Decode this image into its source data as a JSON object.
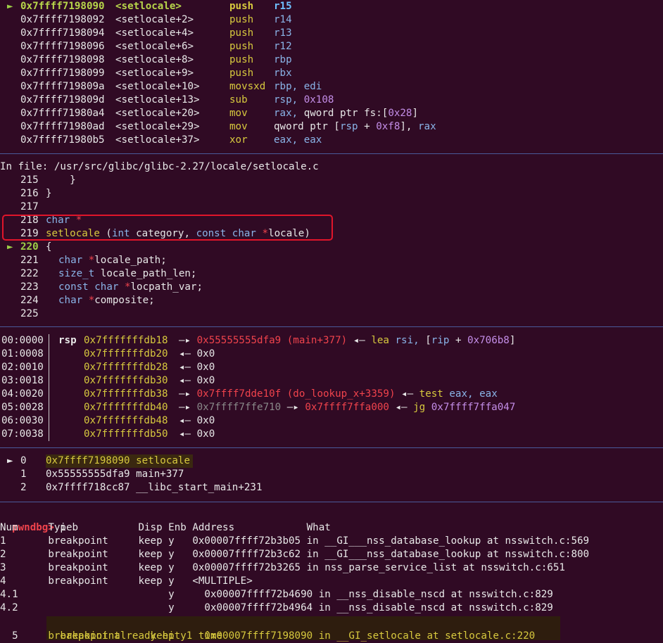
{
  "disasm": [
    {
      "marker": "►",
      "addr": "0x7ffff7198090",
      "sym": "<setlocale>",
      "op": "push",
      "args": "r15",
      "current": true
    },
    {
      "marker": "",
      "addr": "0x7ffff7198092",
      "sym": "<setlocale+2>",
      "op": "push",
      "args": "r14"
    },
    {
      "marker": "",
      "addr": "0x7ffff7198094",
      "sym": "<setlocale+4>",
      "op": "push",
      "args": "r13"
    },
    {
      "marker": "",
      "addr": "0x7ffff7198096",
      "sym": "<setlocale+6>",
      "op": "push",
      "args": "r12"
    },
    {
      "marker": "",
      "addr": "0x7ffff7198098",
      "sym": "<setlocale+8>",
      "op": "push",
      "args": "rbp"
    },
    {
      "marker": "",
      "addr": "0x7ffff7198099",
      "sym": "<setlocale+9>",
      "op": "push",
      "args": "rbx"
    },
    {
      "marker": "",
      "addr": "0x7ffff719809a",
      "sym": "<setlocale+10>",
      "op": "movsxd",
      "a1": "rbp,",
      "a2": "edi"
    },
    {
      "marker": "",
      "addr": "0x7ffff719809d",
      "sym": "<setlocale+13>",
      "op": "sub",
      "a1": "rsp,",
      "a2": "0x108"
    },
    {
      "marker": "",
      "addr": "0x7ffff71980a4",
      "sym": "<setlocale+20>",
      "op": "mov",
      "a1": "rax,",
      "a2": "qword ptr fs:[",
      "a3": "0x28",
      "a4": "]"
    },
    {
      "marker": "",
      "addr": "0x7ffff71980ad",
      "sym": "<setlocale+29>",
      "op": "mov",
      "a1": "qword ptr [",
      "a2": "rsp",
      "a3": " + ",
      "a4": "0xf8",
      "a5": "], ",
      "a6": "rax"
    },
    {
      "marker": "",
      "addr": "0x7ffff71980b5",
      "sym": "<setlocale+37>",
      "op": "xor",
      "a1": "eax,",
      "a2": "eax"
    }
  ],
  "source": {
    "file_line": "In file: /usr/src/glibc/glibc-2.27/locale/setlocale.c",
    "lines": [
      {
        "no": "215",
        "text": "    }"
      },
      {
        "no": "216",
        "text": "}"
      },
      {
        "no": "217",
        "text": ""
      },
      {
        "no": "218",
        "kw": "char",
        "star": " *"
      },
      {
        "no": "219",
        "fn": "setlocale",
        "p1": " (",
        "t1": "int",
        "p2": " category, ",
        "t2": "const char",
        "star": " *",
        "p3": "locale)"
      },
      {
        "no": "220",
        "text": "{",
        "current": true,
        "marker": "►"
      },
      {
        "no": "221",
        "kw": "char",
        "star": " *",
        "rest": "locale_path;"
      },
      {
        "no": "222",
        "kw": "size_t",
        "rest": " locale_path_len;"
      },
      {
        "no": "223",
        "kw": "const char",
        "star": " *",
        "rest": "locpath_var;"
      },
      {
        "no": "224",
        "kw": "char",
        "star": " *",
        "rest": "composite;"
      },
      {
        "no": "225",
        "text": ""
      }
    ]
  },
  "stack": [
    {
      "off": "00:0000",
      "reg": "rsp",
      "addr": "0x7fffffffdb18",
      "arrow": "—▸",
      "target": "0x55555555dfa9 (main+377)",
      "back": "◂—",
      "ins": "lea",
      "a1": "rsi,",
      "a2": "[",
      "a3": "rip",
      "a4": " + ",
      "a5": "0x706b8",
      "a6": "]"
    },
    {
      "off": "01:0008",
      "addr": "0x7fffffffdb20",
      "back": "◂—",
      "val": "0x0"
    },
    {
      "off": "02:0010",
      "addr": "0x7fffffffdb28",
      "back": "◂—",
      "val": "0x0"
    },
    {
      "off": "03:0018",
      "addr": "0x7fffffffdb30",
      "back": "◂—",
      "val": "0x0"
    },
    {
      "off": "04:0020",
      "addr": "0x7fffffffdb38",
      "arrow": "—▸",
      "target": "0x7ffff7dde10f (do_lookup_x+3359)",
      "back": "◂—",
      "ins": "test",
      "a1": "eax,",
      "a2": "eax"
    },
    {
      "off": "05:0028",
      "addr": "0x7fffffffdb40",
      "arrow": "—▸",
      "mid": "0x7ffff7ffe710",
      "arrow2": "—▸",
      "target": "0x7ffff7ffa000",
      "back": "◂—",
      "ins": "jg",
      "a1": "0x7ffff7ffa047"
    },
    {
      "off": "06:0030",
      "addr": "0x7fffffffdb48",
      "back": "◂—",
      "val": "0x0"
    },
    {
      "off": "07:0038",
      "addr": "0x7fffffffdb50",
      "back": "◂—",
      "val": "0x0"
    }
  ],
  "backtrace": [
    {
      "marker": "►",
      "idx": "0",
      "text": "0x7ffff7198090 setlocale",
      "current": true
    },
    {
      "idx": "1",
      "text": "0x55555555dfa9 main+377"
    },
    {
      "idx": "2",
      "text": "0x7ffff718cc87 __libc_start_main+231"
    }
  ],
  "prompt": {
    "name": "pwndbg>",
    "cmd": " i b"
  },
  "bp_header": "Num     Type           Disp Enb Address            What",
  "breakpoints": [
    "1       breakpoint     keep y   0x00007ffff72b3b05 in __GI___nss_database_lookup at nsswitch.c:569",
    "2       breakpoint     keep y   0x00007ffff72b3c62 in __GI___nss_database_lookup at nsswitch.c:800",
    "3       breakpoint     keep y   0x00007ffff72b3265 in nss_parse_service_list at nsswitch.c:651",
    "4       breakpoint     keep y   <MULTIPLE>",
    "4.1                         y     0x00007ffff72b4690 in __nss_disable_nscd at nsswitch.c:829",
    "4.2                         y     0x00007ffff72b4964 in __nss_disable_nscd at nsswitch.c:829"
  ],
  "bp5": {
    "num": "5       ",
    "text": "breakpoint     keep y   0x00007ffff7198090 in __GI_setlocale at setlocale.c:220",
    "hit": "        breakpoint already hit 1 time"
  }
}
